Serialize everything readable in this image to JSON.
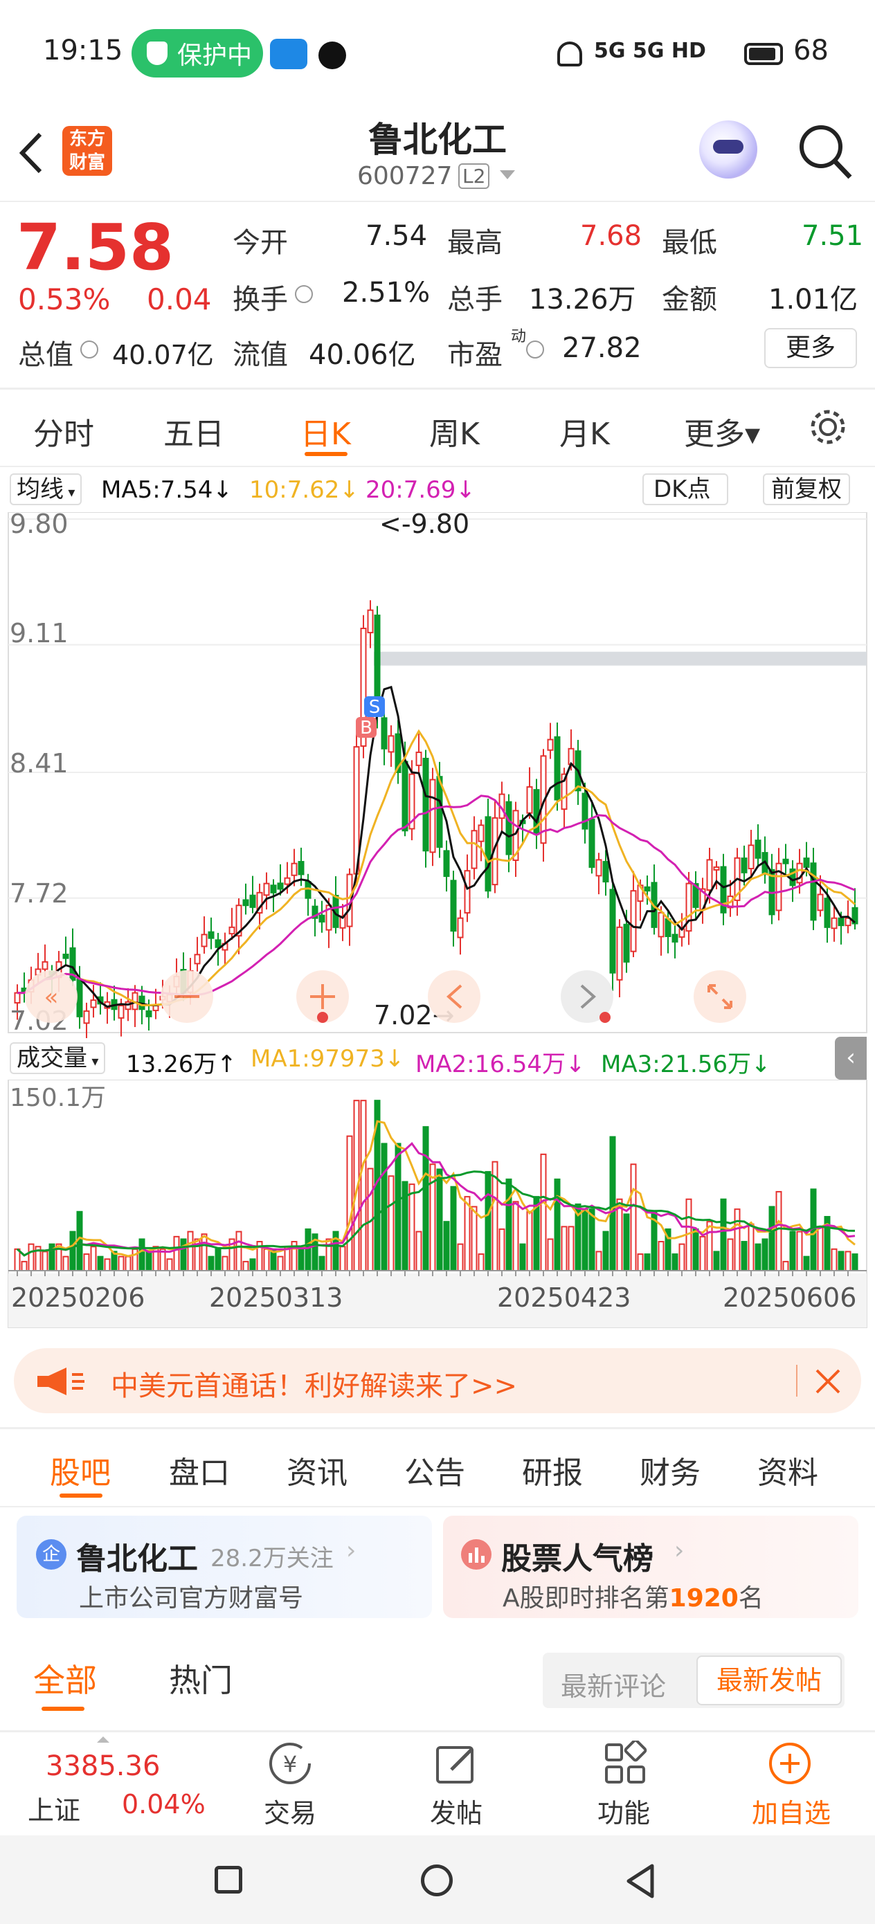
{
  "status": {
    "time": "19:15",
    "protect": "保护中",
    "net": "5G  5G  HD",
    "battery": "68"
  },
  "header": {
    "name": "鲁北化工",
    "code": "600727",
    "level": "L2",
    "logo_top": "东方",
    "logo_bottom": "财富"
  },
  "quote": {
    "price": "7.58",
    "pct": "0.53%",
    "chg": "0.04",
    "open_label": "今开",
    "open": "7.54",
    "high_label": "最高",
    "high": "7.68",
    "low_label": "最低",
    "low": "7.51",
    "turnover_label": "换手",
    "turnover": "2.51%",
    "vol_label": "总手",
    "vol": "13.26万",
    "amount_label": "金额",
    "amount": "1.01亿",
    "mcap_label": "总值",
    "mcap": "40.07亿",
    "float_label": "流值",
    "float": "40.06亿",
    "pe_label": "市盈",
    "pe_sup": "动",
    "pe": "27.82",
    "more": "更多"
  },
  "tabs": [
    "分时",
    "五日",
    "日K",
    "周K",
    "月K",
    "更多▾"
  ],
  "active_tab": "日K",
  "ma_bar": {
    "sel": "均线",
    "ma5": "MA5:7.54↓",
    "ma10": "10:7.62↓",
    "ma20": "20:7.69↓",
    "dk": "DK点",
    "fq": "前复权"
  },
  "chart_data": {
    "type": "candlestick",
    "y_ticks": [
      "9.80",
      "9.11",
      "8.41",
      "7.72",
      "7.02"
    ],
    "ylim": [
      7.02,
      9.8
    ],
    "max_label": "<-9.80",
    "min_label": "7.02→",
    "x_labels": [
      "20250206",
      "20250313",
      "20250423",
      "20250606"
    ],
    "close": [
      7.2,
      7.2,
      7.27,
      7.33,
      7.37,
      7.3,
      7.37,
      7.39,
      7.27,
      7.07,
      7.1,
      7.16,
      7.14,
      7.15,
      7.11,
      7.13,
      7.15,
      7.2,
      7.11,
      7.07,
      7.13,
      7.18,
      7.19,
      7.29,
      7.2,
      7.32,
      7.41,
      7.52,
      7.5,
      7.45,
      7.47,
      7.56,
      7.68,
      7.68,
      7.67,
      7.75,
      7.8,
      7.75,
      7.77,
      7.83,
      7.91,
      7.85,
      7.72,
      7.61,
      7.59,
      7.68,
      7.56,
      7.62,
      7.85,
      8.55,
      9.2,
      9.3,
      8.74,
      8.54,
      8.61,
      8.41,
      8.09,
      8.4,
      8.52,
      7.98,
      8.37,
      8.0,
      7.84,
      7.54,
      7.61,
      7.87,
      8.09,
      8.12,
      7.76,
      8.16,
      8.29,
      7.96,
      8.2,
      8.13,
      8.33,
      8.07,
      8.5,
      8.59,
      8.26,
      8.4,
      8.54,
      8.31,
      8.1,
      7.89,
      7.93,
      7.81,
      7.31,
      7.56,
      7.37,
      7.76,
      7.79,
      7.76,
      7.56,
      7.64,
      7.51,
      7.48,
      7.55,
      7.8,
      7.67,
      7.77,
      7.93,
      7.89,
      7.64,
      7.73,
      7.94,
      7.86,
      8.01,
      7.94,
      7.85,
      7.63,
      7.91,
      7.91,
      7.79,
      7.91,
      7.89,
      7.6,
      7.74,
      7.56,
      7.61,
      7.57,
      7.61,
      7.58
    ],
    "volume_ylim": [
      0,
      150.1
    ],
    "volume_max_label": "150.1万",
    "series": [
      {
        "name": "MA5",
        "value": "7.54"
      },
      {
        "name": "10",
        "value": "7.62"
      },
      {
        "name": "20",
        "value": "7.69"
      }
    ],
    "signals": [
      "B",
      "S"
    ]
  },
  "vol_bar": {
    "sel": "成交量",
    "vol": "13.26万↑",
    "ma1": "MA1:97973↓",
    "ma2": "MA2:16.54万↓",
    "ma3": "MA3:21.56万↓"
  },
  "banner": {
    "text": "中美元首通话！利好解读来了>>"
  },
  "sub_tabs": [
    "股吧",
    "盘口",
    "资讯",
    "公告",
    "研报",
    "财务",
    "资料"
  ],
  "card1": {
    "title": "鲁北化工",
    "follow": "28.2万关注",
    "sub": "上市公司官方财富号",
    "badge": "企"
  },
  "card2": {
    "title": "股票人气榜",
    "sub_pre": "A股即时排名第",
    "rank": "1920",
    "sub_post": "名"
  },
  "filter": {
    "all": "全部",
    "hot": "热门",
    "latest_comment": "最新评论",
    "latest_post": "最新发帖"
  },
  "bottom": {
    "index_value": "3385.36",
    "index_name": "上证",
    "index_pct": "0.04%",
    "trade": "交易",
    "post": "发帖",
    "func": "功能",
    "add": "加自选"
  },
  "colors": {
    "up": "#e5312f",
    "down": "#0a9a2c",
    "accent": "#ff6a00",
    "ma5": "#111111",
    "ma10": "#f0b323",
    "ma20": "#d321b2"
  }
}
